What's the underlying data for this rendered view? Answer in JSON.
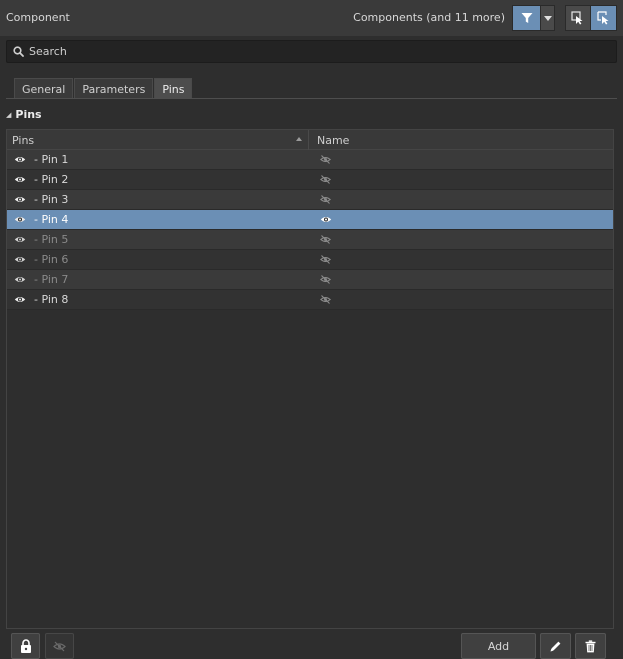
{
  "header": {
    "title": "Component",
    "context": "Components (and 11 more)"
  },
  "search": {
    "placeholder": "Search"
  },
  "tabs": [
    {
      "label": "General",
      "active": false
    },
    {
      "label": "Parameters",
      "active": false
    },
    {
      "label": "Pins",
      "active": true
    }
  ],
  "section": {
    "title": "Pins"
  },
  "table": {
    "columns": [
      "Pins",
      "Name"
    ],
    "rows": [
      {
        "label": "- Pin 1",
        "pin_visible": true,
        "name_visible": false
      },
      {
        "label": "- Pin 2",
        "pin_visible": true,
        "name_visible": false
      },
      {
        "label": "- Pin 3",
        "pin_visible": true,
        "name_visible": false
      },
      {
        "label": "- Pin 4",
        "pin_visible": true,
        "name_visible": true,
        "selected": true
      },
      {
        "label": "- Pin 5",
        "pin_visible": true,
        "name_visible": false,
        "dim": true
      },
      {
        "label": "- Pin 6",
        "pin_visible": true,
        "name_visible": false,
        "dim": true
      },
      {
        "label": "- Pin 7",
        "pin_visible": true,
        "name_visible": false,
        "dim": true
      },
      {
        "label": "- Pin 8",
        "pin_visible": true,
        "name_visible": false
      }
    ]
  },
  "footer": {
    "add_label": "Add"
  },
  "icons": {
    "filter": "filter-icon",
    "select_inside": "select-inside-icon",
    "select_touching": "select-touching-icon",
    "search": "search-icon",
    "lock": "lock-icon",
    "hide": "eye-off-icon",
    "edit": "pencil-icon",
    "delete": "trash-icon"
  },
  "colors": {
    "accent": "#6b8fb5",
    "background": "#2e2e2e"
  }
}
